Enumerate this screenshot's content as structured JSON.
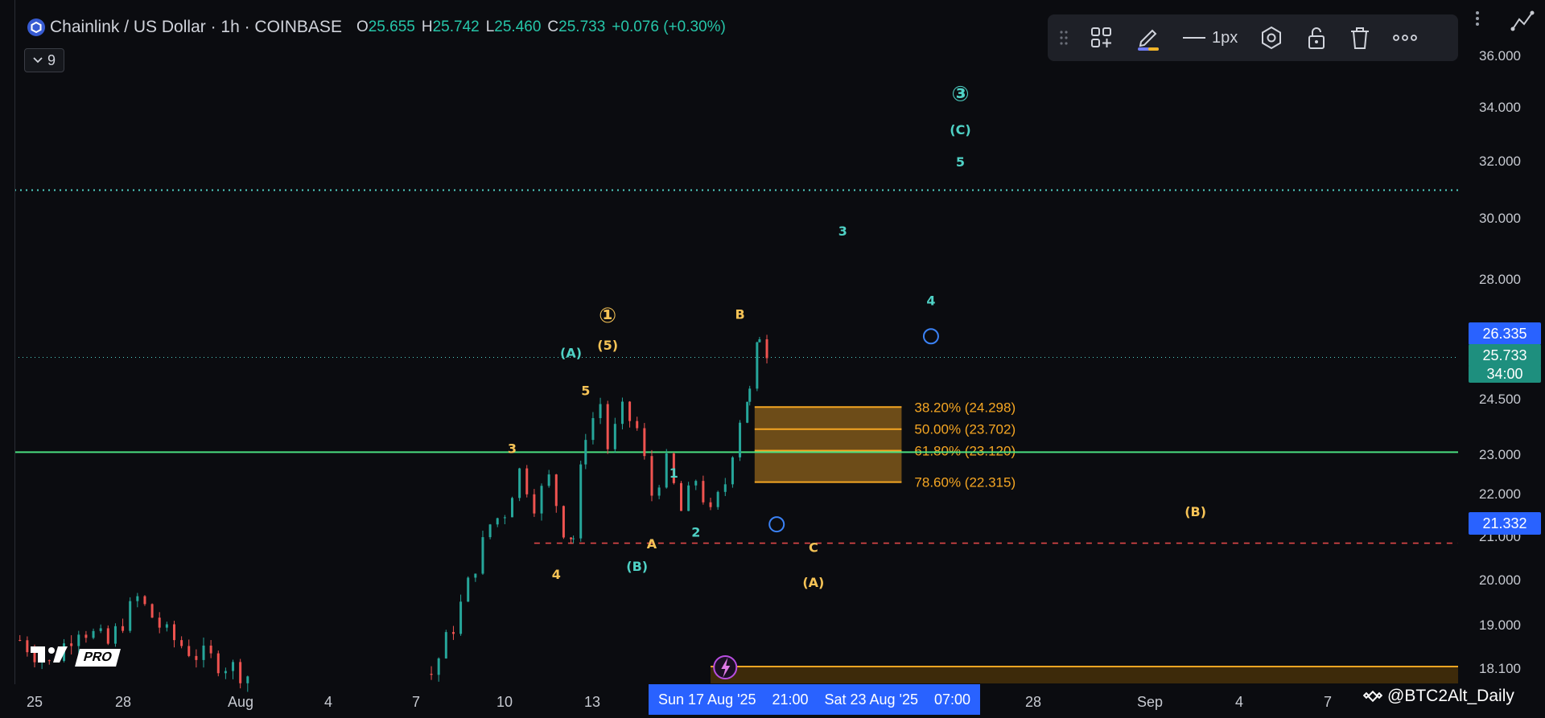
{
  "header": {
    "symbol_title": "Chainlink / US Dollar · 1h · COINBASE",
    "ohlc": [
      {
        "k": "O",
        "v": "25.655"
      },
      {
        "k": "H",
        "v": "25.742"
      },
      {
        "k": "L",
        "v": "25.460"
      },
      {
        "k": "C",
        "v": "25.733"
      },
      {
        "k": "",
        "v": "+0.076 (+0.30%)"
      }
    ],
    "indicator_count": "9"
  },
  "toolbar": {
    "line_width_label": "1px",
    "icons": [
      "drag-handle-icon",
      "add-objects-icon",
      "pencil-icon",
      "line-style-icon",
      "settings-hex-icon",
      "lock-icon",
      "trash-icon",
      "more-icon"
    ]
  },
  "colors": {
    "background": "#0b0c10",
    "candle_up": "#26a69a",
    "candle_down": "#ef5350",
    "green_line": "#4ade80",
    "fib_gold": "#f5a623",
    "wave_teal": "#4fd1c5",
    "wave_gold": "#f6c356",
    "tag_blue": "#2962ff",
    "tag_teal": "#1e8f7e",
    "red_dash": "#e04848"
  },
  "time_axis": {
    "ticks": [
      "25",
      "28",
      "Aug",
      "4",
      "7",
      "10",
      "13",
      "28",
      "Sep",
      "4",
      "7"
    ],
    "crosshair_label_left": "Sun 17 Aug '25",
    "crosshair_time_left": "21:00",
    "crosshair_label_right": "Sat 23 Aug '25",
    "crosshair_time_right": "07:00"
  },
  "price_tags": [
    {
      "label": "26.335",
      "color": "#2962ff",
      "price": 26.335
    },
    {
      "label": "25.733",
      "color": "#1e8f7e",
      "price": 25.733
    },
    {
      "label": "34:00",
      "color": "#1e8f7e",
      "price": 25.733
    },
    {
      "label": "21.332",
      "color": "#2962ff",
      "price": 21.332
    }
  ],
  "chart_data": {
    "type": "candlestick",
    "title": "Chainlink / US Dollar · 1h · COINBASE",
    "y_ticks": [
      "36.000",
      "34.000",
      "32.000",
      "30.000",
      "28.000",
      "24.500",
      "23.000",
      "22.000",
      "21.000",
      "20.000",
      "19.000",
      "18.100"
    ],
    "y_tick_values": [
      36.0,
      34.0,
      32.0,
      30.0,
      28.0,
      24.5,
      23.0,
      22.0,
      21.0,
      20.0,
      19.0,
      18.1
    ],
    "ylim": [
      17.8,
      36.6
    ],
    "xlim_days": [
      "Jul 24 '25",
      "Sep 10 '25"
    ],
    "price_path": [
      [
        "Jul 24 12:00",
        18.7
      ],
      [
        "Jul 25 12:00",
        18.2
      ],
      [
        "Jul 26 12:00",
        19.0
      ],
      [
        "Jul 27 12:00",
        18.6
      ],
      [
        "Jul 28 12:00",
        19.6
      ],
      [
        "Jul 29 12:00",
        18.8
      ],
      [
        "Jul 30 12:00",
        18.4
      ],
      [
        "Jul 31 12:00",
        18.2
      ],
      [
        "Aug 1 12:00",
        17.9
      ],
      [
        "Aug 7 12:00",
        18.0
      ],
      [
        "Aug 8 06:00",
        19.0
      ],
      [
        "Aug 8 18:00",
        19.9
      ],
      [
        "Aug 9 12:00",
        21.3
      ],
      [
        "Aug 10 00:00",
        21.6
      ],
      [
        "Aug 10 12:00",
        22.6
      ],
      [
        "Aug 11 00:00",
        21.8
      ],
      [
        "Aug 11 12:00",
        22.4
      ],
      [
        "Aug 12 00:00",
        21.2
      ],
      [
        "Aug 12 08:00",
        21.0
      ],
      [
        "Aug 12 18:00",
        23.6
      ],
      [
        "Aug 13 06:00",
        24.4
      ],
      [
        "Aug 13 12:00",
        23.2
      ],
      [
        "Aug 14 00:00",
        24.2
      ],
      [
        "Aug 14 12:00",
        23.7
      ],
      [
        "Aug 15 00:00",
        22.0
      ],
      [
        "Aug 15 12:00",
        22.8
      ],
      [
        "Aug 16 00:00",
        21.6
      ],
      [
        "Aug 16 12:00",
        22.4
      ],
      [
        "Aug 17 00:00",
        21.5
      ],
      [
        "Aug 17 12:00",
        22.3
      ],
      [
        "Aug 18 00:00",
        24.0
      ],
      [
        "Aug 18 08:00",
        24.7
      ],
      [
        "Aug 18 16:00",
        26.4
      ],
      [
        "Aug 19 00:00",
        25.73
      ]
    ],
    "levels": [
      {
        "name": "green-support",
        "price": 23.08,
        "style": "solid"
      },
      {
        "name": "teal-target",
        "price": 31.0,
        "style": "dotted"
      },
      {
        "name": "red-support",
        "price": 20.86,
        "style": "dashed"
      },
      {
        "name": "current-price",
        "price": 25.733,
        "style": "dotted"
      }
    ],
    "fib_levels": [
      {
        "label": "38.20% (24.298)",
        "price": 24.298
      },
      {
        "label": "50.00% (23.702)",
        "price": 23.702
      },
      {
        "label": "61.80% (23.120)",
        "price": 23.12
      },
      {
        "label": "78.60% (22.315)",
        "price": 22.315
      }
    ],
    "fib_zone": {
      "from": "Aug 18 12:00",
      "to": "Aug 23 12:00"
    },
    "bottom_zone": {
      "from": "Aug 17 00:00",
      "top": 18.15,
      "bottom": 17.8
    },
    "wave_labels": [
      {
        "text": "①",
        "date": "Aug 13 12:00",
        "price": 26.9,
        "color": "gold"
      },
      {
        "text": "(5)",
        "date": "Aug 13 12:00",
        "price": 26.1,
        "color": "gold"
      },
      {
        "text": "(A)",
        "date": "Aug 12 06:00",
        "price": 25.88,
        "color": "teal"
      },
      {
        "text": "5",
        "date": "Aug 12 18:00",
        "price": 24.77,
        "color": "gold"
      },
      {
        "text": "3",
        "date": "Aug 10 06:00",
        "price": 23.18,
        "color": "gold"
      },
      {
        "text": "4",
        "date": "Aug 11 18:00",
        "price": 20.15,
        "color": "gold"
      },
      {
        "text": "(B)",
        "date": "Aug 14 12:00",
        "price": 20.33,
        "color": "teal"
      },
      {
        "text": "A",
        "date": "Aug 15 00:00",
        "price": 20.85,
        "color": "gold"
      },
      {
        "text": "1",
        "date": "Aug 15 18:00",
        "price": 22.55,
        "color": "teal"
      },
      {
        "text": "2",
        "date": "Aug 16 12:00",
        "price": 21.12,
        "color": "teal"
      },
      {
        "text": "B",
        "date": "Aug 18 00:00",
        "price": 27.0,
        "color": "gold"
      },
      {
        "text": "C",
        "date": "Aug 20 12:00",
        "price": 20.77,
        "color": "gold"
      },
      {
        "text": "(A)",
        "date": "Aug 20 12:00",
        "price": 19.96,
        "color": "gold"
      },
      {
        "text": "3",
        "date": "Aug 21 12:00",
        "price": 29.6,
        "color": "teal"
      },
      {
        "text": "4",
        "date": "Aug 24 12:00",
        "price": 27.4,
        "color": "teal"
      },
      {
        "text": "5",
        "date": "Aug 25 12:00",
        "price": 32.0,
        "color": "teal"
      },
      {
        "text": "(C)",
        "date": "Aug 25 12:00",
        "price": 33.2,
        "color": "teal"
      },
      {
        "text": "③",
        "date": "Aug 25 12:00",
        "price": 34.46,
        "color": "teal"
      },
      {
        "text": "(B)",
        "date": "Sep 2 12:00",
        "price": 21.6,
        "color": "gold"
      }
    ],
    "markers": [
      {
        "name": "blue-circle-marker",
        "date": "Aug 24 12:00",
        "price": 26.35
      },
      {
        "name": "blue-circle-marker",
        "date": "Aug 19 06:00",
        "price": 21.3
      }
    ]
  },
  "watermark": "@BTC2Alt_Daily",
  "tv_badge": "PRO"
}
